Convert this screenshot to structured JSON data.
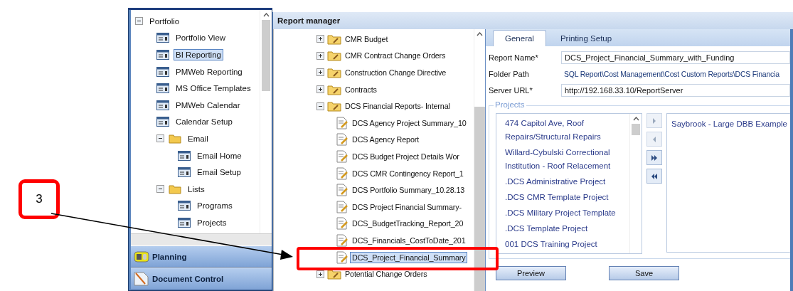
{
  "callout": {
    "label": "3"
  },
  "nav_tree": [
    {
      "label": "Portfolio",
      "kind": "folder",
      "expanded": true,
      "selected": false,
      "children": [
        {
          "label": "Portfolio View",
          "kind": "page",
          "selected": false
        },
        {
          "label": "BI Reporting",
          "kind": "page",
          "selected": true
        },
        {
          "label": "PMWeb Reporting",
          "kind": "page",
          "selected": false
        },
        {
          "label": "MS Office Templates",
          "kind": "page",
          "selected": false
        },
        {
          "label": "PMWeb Calendar",
          "kind": "page",
          "selected": false
        },
        {
          "label": "Calendar Setup",
          "kind": "page",
          "selected": false
        },
        {
          "label": "Email",
          "kind": "folder",
          "expanded": true,
          "selected": false,
          "children": [
            {
              "label": "Email Home",
              "kind": "page",
              "selected": false
            },
            {
              "label": "Email Setup",
              "kind": "page",
              "selected": false
            }
          ]
        },
        {
          "label": "Lists",
          "kind": "folder",
          "expanded": true,
          "selected": false,
          "children": [
            {
              "label": "Programs",
              "kind": "page",
              "selected": false
            },
            {
              "label": "Projects",
              "kind": "page",
              "selected": false
            }
          ]
        }
      ]
    }
  ],
  "nav_sections": [
    {
      "label": "Planning",
      "kind": "planning"
    },
    {
      "label": "Document Control",
      "kind": "document"
    }
  ],
  "report_manager": {
    "title": "Report manager",
    "tree": [
      {
        "label": "CMR Budget",
        "kind": "folder",
        "expanded": false,
        "selected": false
      },
      {
        "label": "CMR Contract Change Orders",
        "kind": "folder",
        "expanded": false,
        "selected": false
      },
      {
        "label": "Construction Change Directive",
        "kind": "folder",
        "expanded": false,
        "selected": false
      },
      {
        "label": "Contracts",
        "kind": "folder",
        "expanded": false,
        "selected": false
      },
      {
        "label": "DCS Financial Reports- Internal",
        "kind": "folder",
        "expanded": true,
        "selected": false,
        "children": [
          {
            "label": "DCS Agency Project Summary_10",
            "kind": "report",
            "selected": false
          },
          {
            "label": "DCS Agency Report",
            "kind": "report",
            "selected": false
          },
          {
            "label": "DCS Budget Project Details Wor",
            "kind": "report",
            "selected": false
          },
          {
            "label": "DCS CMR Contingency Report_1",
            "kind": "report",
            "selected": false
          },
          {
            "label": "DCS Portfolio Summary_10.28.13",
            "kind": "report",
            "selected": false
          },
          {
            "label": "DCS Project Financial Summary-",
            "kind": "report",
            "selected": false
          },
          {
            "label": "DCS_BudgetTracking_Report_20",
            "kind": "report",
            "selected": false
          },
          {
            "label": "DCS_Financials_CostToDate_201",
            "kind": "report",
            "selected": false
          },
          {
            "label": "DCS_Project_Financial_Summary",
            "kind": "report",
            "selected": true
          }
        ]
      },
      {
        "label": "Potential Change Orders",
        "kind": "folder",
        "expanded": false,
        "selected": false
      }
    ],
    "tabs": [
      {
        "label": "General",
        "selected": true
      },
      {
        "label": "Printing Setup",
        "selected": false
      }
    ],
    "fields": [
      {
        "label": "Report Name*",
        "value": "DCS_Project_Financial_Summary_with_Funding",
        "kind": "input"
      },
      {
        "label": "Folder Path",
        "value": "SQL Report\\Cost Management\\Cost Custom Reports\\DCS Financia",
        "kind": "text"
      },
      {
        "label": "Server URL*",
        "value": "http://192.168.33.10/ReportServer",
        "kind": "input"
      }
    ],
    "projects": {
      "title": "Projects",
      "available": [
        "474 Capitol Ave, Roof Repairs/Structural Repairs",
        "Willard-Cybulski Correctional Institution - Roof Relacement",
        ".DCS Administrative Project",
        ".DCS CMR Template Project",
        ".DCS Military Project Template",
        ".DCS Template Project",
        "001 DCS Training Project"
      ],
      "move_buttons": [
        {
          "kind": "right",
          "disabled": true
        },
        {
          "kind": "left",
          "disabled": true
        },
        {
          "kind": "all-right",
          "disabled": false
        },
        {
          "kind": "all-left",
          "disabled": false
        }
      ],
      "selected_list": [
        "Saybrook - Large DBB Example"
      ]
    },
    "buttons": [
      "Preview",
      "Save"
    ]
  }
}
